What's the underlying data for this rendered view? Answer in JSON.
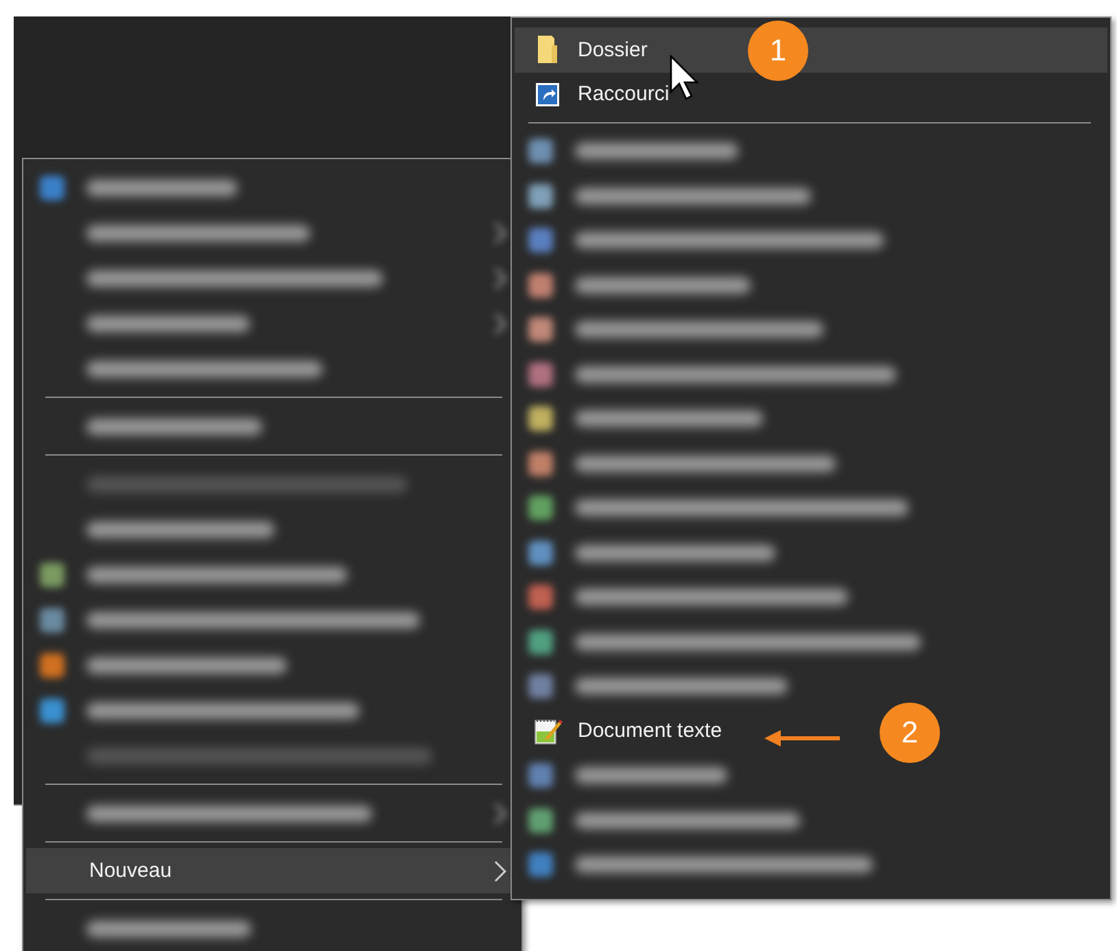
{
  "context_menu": {
    "items": [
      {
        "kind": "blurred",
        "color": "#3a80c8",
        "submenu": false,
        "disabled": false
      },
      {
        "kind": "blurred",
        "submenu": true,
        "disabled": false
      },
      {
        "kind": "blurred",
        "submenu": true,
        "disabled": false
      },
      {
        "kind": "blurred",
        "submenu": true,
        "disabled": false
      },
      {
        "kind": "blurred",
        "submenu": false,
        "disabled": false
      },
      {
        "kind": "separator"
      },
      {
        "kind": "blurred",
        "submenu": false,
        "disabled": false
      },
      {
        "kind": "separator"
      },
      {
        "kind": "blurred",
        "submenu": false,
        "disabled": true
      },
      {
        "kind": "blurred",
        "submenu": false,
        "disabled": false
      },
      {
        "kind": "blurred",
        "color": "#7a9a60",
        "submenu": false,
        "disabled": false
      },
      {
        "kind": "blurred",
        "color": "#6a8aa0",
        "submenu": false,
        "disabled": false
      },
      {
        "kind": "blurred",
        "color": "#d07020",
        "submenu": false,
        "disabled": false
      },
      {
        "kind": "blurred",
        "color": "#3a90d0",
        "submenu": false,
        "disabled": false
      },
      {
        "kind": "blurred",
        "submenu": false,
        "disabled": true
      },
      {
        "kind": "separator"
      },
      {
        "kind": "blurred",
        "submenu": true,
        "disabled": false
      },
      {
        "kind": "separator"
      },
      {
        "kind": "item",
        "label": "Nouveau",
        "selected": true,
        "submenu": true
      },
      {
        "kind": "separator"
      },
      {
        "kind": "blurred",
        "submenu": false,
        "disabled": false
      }
    ]
  },
  "submenu": {
    "items": [
      {
        "kind": "folder",
        "label": "Dossier",
        "selected": true
      },
      {
        "kind": "shortcut",
        "label": "Raccourci",
        "selected": false
      },
      {
        "kind": "separator"
      },
      {
        "kind": "blurred",
        "color": "#6e8fb0"
      },
      {
        "kind": "blurred",
        "color": "#7fa0b8"
      },
      {
        "kind": "blurred",
        "color": "#5a7fc0"
      },
      {
        "kind": "blurred",
        "color": "#c08070"
      },
      {
        "kind": "blurred",
        "color": "#c08878"
      },
      {
        "kind": "blurred",
        "color": "#b07080"
      },
      {
        "kind": "blurred",
        "color": "#c0b060"
      },
      {
        "kind": "blurred",
        "color": "#c08068"
      },
      {
        "kind": "blurred",
        "color": "#60a060"
      },
      {
        "kind": "blurred",
        "color": "#6090c0"
      },
      {
        "kind": "blurred",
        "color": "#c06050"
      },
      {
        "kind": "blurred",
        "color": "#50a080"
      },
      {
        "kind": "blurred",
        "color": "#7080a0"
      },
      {
        "kind": "textfile",
        "label": "Document texte",
        "selected": false
      },
      {
        "kind": "blurred",
        "color": "#6080b0"
      },
      {
        "kind": "blurred",
        "color": "#60a070"
      },
      {
        "kind": "blurred",
        "color": "#4080c0"
      }
    ]
  },
  "annotations": [
    {
      "label": "1"
    },
    {
      "label": "2"
    }
  ]
}
